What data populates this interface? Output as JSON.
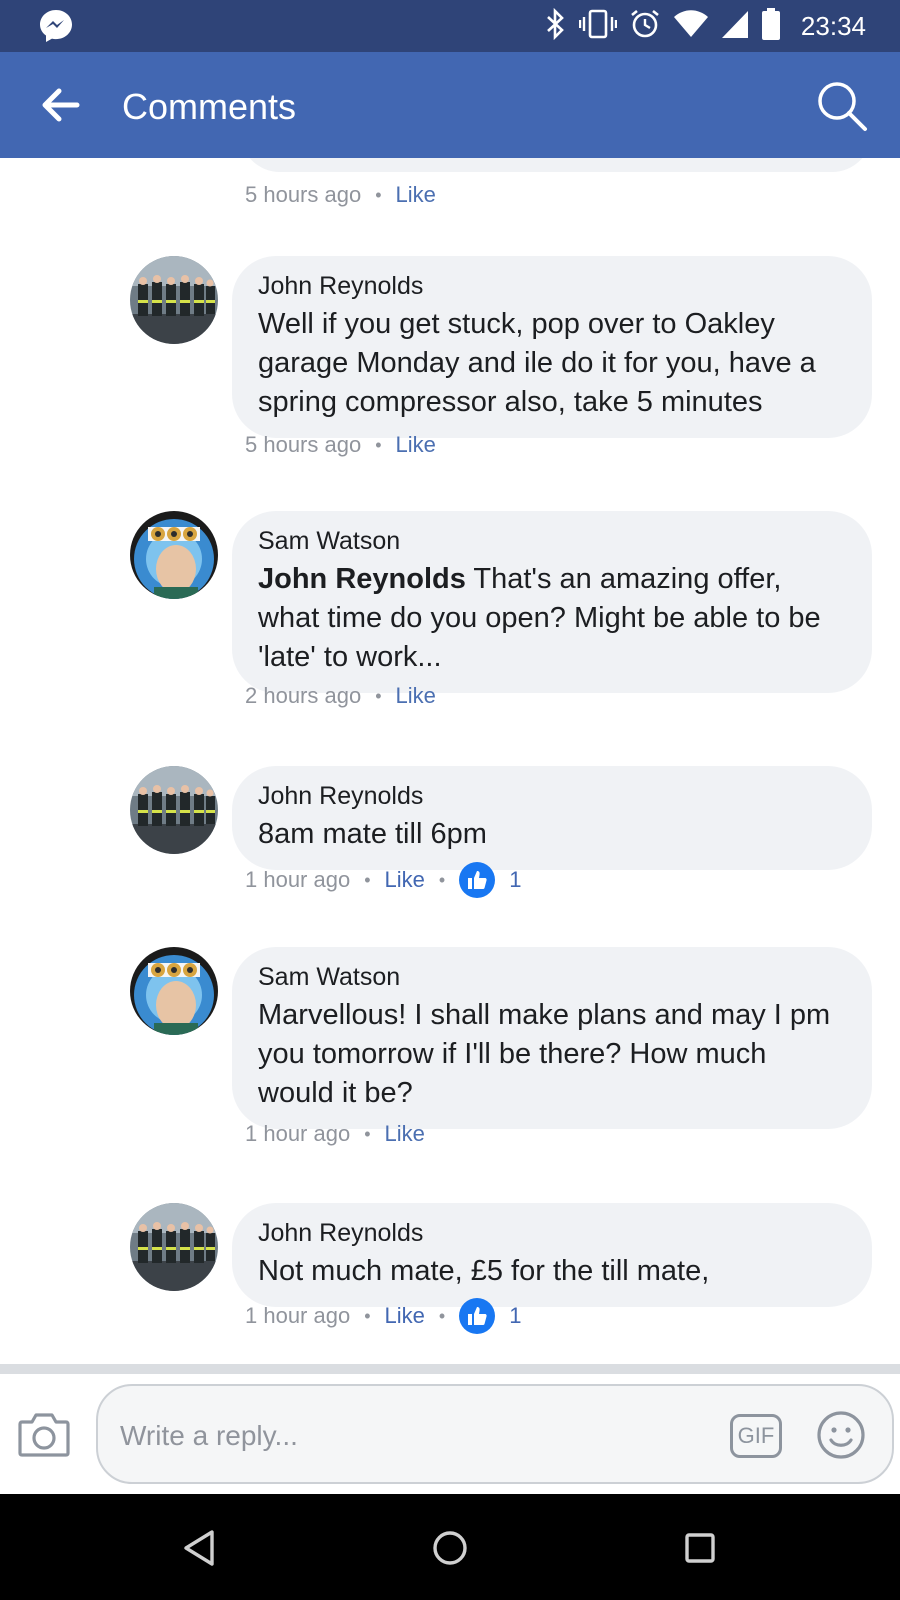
{
  "status_bar": {
    "time": "23:34",
    "icons": [
      "messenger-icon",
      "bluetooth-icon",
      "vibrate-icon",
      "alarm-icon",
      "wifi-icon",
      "signal-icon",
      "battery-icon"
    ]
  },
  "header": {
    "title": "Comments",
    "back_icon": "back-arrow-icon",
    "search_icon": "search-icon"
  },
  "previous_comment": {
    "time": "5 hours ago",
    "like": "Like"
  },
  "comments": [
    {
      "author": "John Reynolds",
      "text": "Well if you get stuck, pop over to Oakley garage Monday and ile do it for you, have a spring compressor also, take 5 minutes",
      "time": "5 hours ago",
      "like": "Like"
    },
    {
      "author": "Sam Watson",
      "mention": "John Reynolds",
      "text": " That's an amazing offer, what time do you open? Might be able to be 'late' to work...",
      "time": "2 hours ago",
      "like": "Like"
    },
    {
      "author": "John Reynolds",
      "text": "8am mate till 6pm",
      "time": "1 hour ago",
      "like": "Like",
      "reaction_count": "1"
    },
    {
      "author": "Sam Watson",
      "text": "Marvellous! I shall make plans and may I pm you tomorrow if I'll be there? How much would it be?",
      "time": "1 hour ago",
      "like": "Like"
    },
    {
      "author": "John Reynolds",
      "text": "Not much mate, £5 for the till mate,",
      "time": "1 hour ago",
      "like": "Like",
      "reaction_count": "1"
    }
  ],
  "composer": {
    "placeholder": "Write a reply...",
    "gif_label": "GIF"
  },
  "colors": {
    "status_bar": "#2f4478",
    "app_bar": "#4267b2",
    "bubble": "#f0f2f5",
    "like_blue": "#1877f2"
  }
}
